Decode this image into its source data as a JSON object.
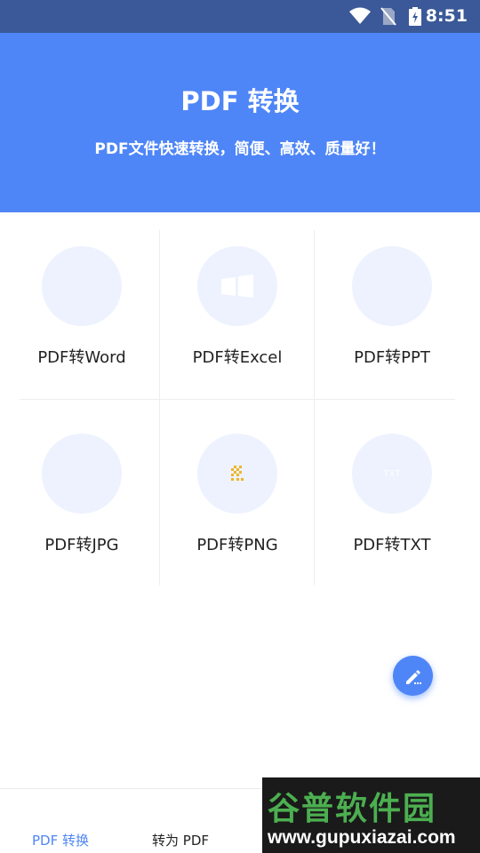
{
  "status_bar": {
    "time": "8:51"
  },
  "header": {
    "title": "PDF 转换",
    "subtitle": "PDF文件快速转换，简便、高效、质量好！"
  },
  "tools": [
    {
      "label": "PDF转Word",
      "icon": "word-icon"
    },
    {
      "label": "PDF转Excel",
      "icon": "excel-icon"
    },
    {
      "label": "PDF转PPT",
      "icon": "ppt-icon"
    },
    {
      "label": "PDF转JPG",
      "icon": "jpg-icon"
    },
    {
      "label": "PDF转PNG",
      "icon": "png-icon"
    },
    {
      "label": "PDF转TXT",
      "icon": "txt-icon",
      "icon_text": "TXT"
    }
  ],
  "bottom_nav": {
    "tabs": [
      {
        "label": "PDF 转换",
        "active": true
      },
      {
        "label": "转为 PDF",
        "active": false
      }
    ]
  },
  "watermark": {
    "line1": "谷普软件园",
    "line2": "www.gupuxiazai.com"
  },
  "colors": {
    "accent": "#4f86f7",
    "status_bar": "#3b5998",
    "icon_bg": "#edf2fe",
    "png_icon": "#f0b429"
  }
}
